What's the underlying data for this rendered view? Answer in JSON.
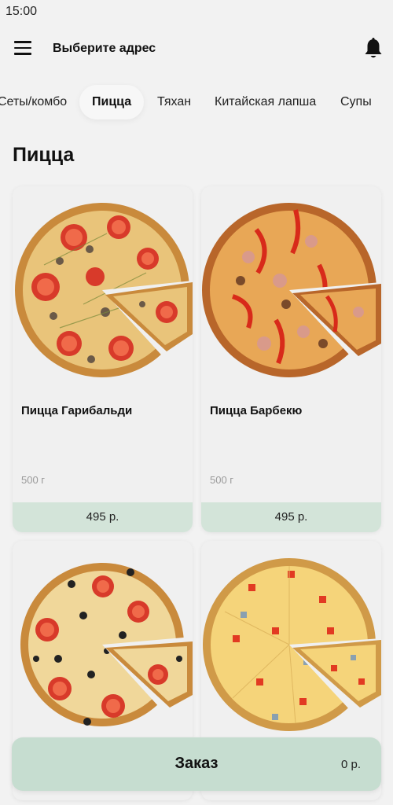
{
  "status_bar": {
    "time": "15:00"
  },
  "header": {
    "address_label": "Выберите адрес"
  },
  "categories": [
    {
      "label": "Сеты/комбо",
      "active": false
    },
    {
      "label": "Пицца",
      "active": true
    },
    {
      "label": "Тяхан",
      "active": false
    },
    {
      "label": "Китайская лапша",
      "active": false
    },
    {
      "label": "Супы",
      "active": false
    }
  ],
  "section": {
    "title": "Пицца"
  },
  "products": [
    {
      "name": "Пицца Гарибальди",
      "weight": "500 г",
      "price": "495 р."
    },
    {
      "name": "Пицца Барбекю",
      "weight": "500 г",
      "price": "495 р."
    },
    {
      "name": "",
      "weight": "",
      "price": ""
    },
    {
      "name": "",
      "weight": "",
      "price": ""
    }
  ],
  "order": {
    "label": "Заказ",
    "total": "0 р."
  },
  "colors": {
    "background": "#f2f2f2",
    "price_bar": "#d3e4d9",
    "order_bar": "#c6ddd0"
  }
}
